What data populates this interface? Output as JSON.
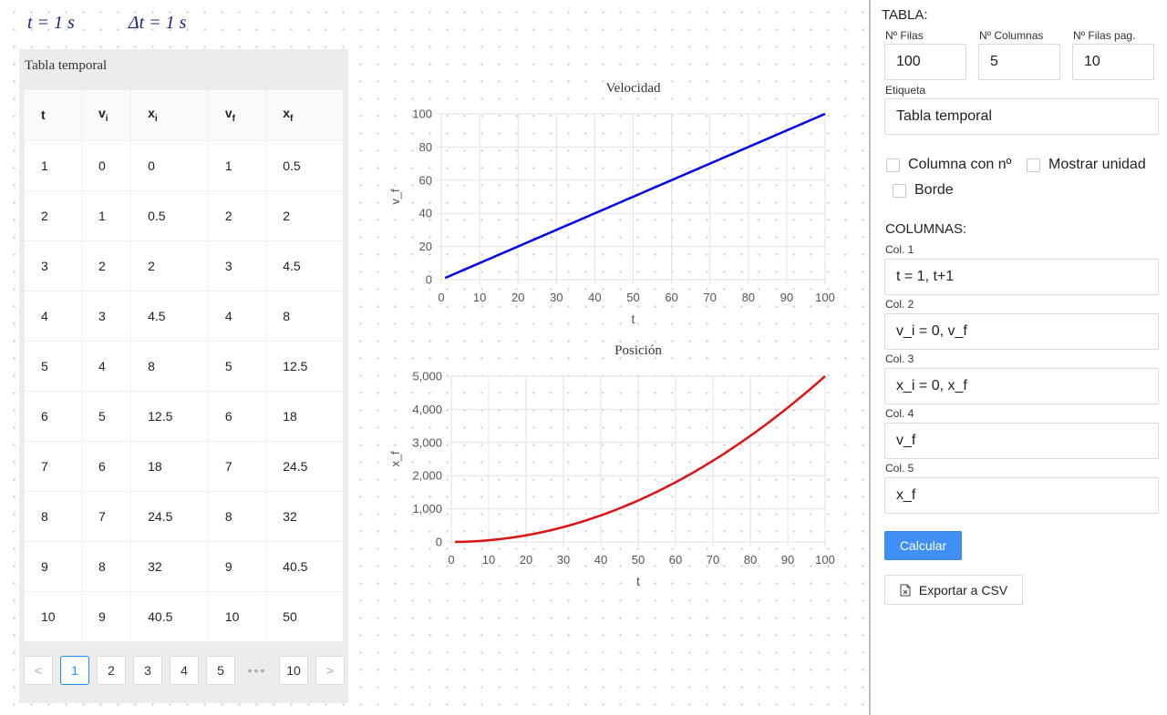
{
  "readout": {
    "time": "t = 1 s",
    "dt": "Δt = 1 s"
  },
  "table": {
    "caption": "Tabla temporal",
    "headers": [
      {
        "base": "t",
        "sub": ""
      },
      {
        "base": "v",
        "sub": "i"
      },
      {
        "base": "x",
        "sub": "i"
      },
      {
        "base": "v",
        "sub": "f"
      },
      {
        "base": "x",
        "sub": "f"
      }
    ],
    "rows": [
      [
        "1",
        "0",
        "0",
        "1",
        "0.5"
      ],
      [
        "2",
        "1",
        "0.5",
        "2",
        "2"
      ],
      [
        "3",
        "2",
        "2",
        "3",
        "4.5"
      ],
      [
        "4",
        "3",
        "4.5",
        "4",
        "8"
      ],
      [
        "5",
        "4",
        "8",
        "5",
        "12.5"
      ],
      [
        "6",
        "5",
        "12.5",
        "6",
        "18"
      ],
      [
        "7",
        "6",
        "18",
        "7",
        "24.5"
      ],
      [
        "8",
        "7",
        "24.5",
        "8",
        "32"
      ],
      [
        "9",
        "8",
        "32",
        "9",
        "40.5"
      ],
      [
        "10",
        "9",
        "40.5",
        "10",
        "50"
      ]
    ]
  },
  "pagination": {
    "prev": "<",
    "pages": [
      "1",
      "2",
      "3",
      "4",
      "5"
    ],
    "ellipsis": "•••",
    "last": "10",
    "next": ">",
    "current": "1"
  },
  "chart_data": [
    {
      "type": "line",
      "title": "Velocidad",
      "xlabel": "t",
      "ylabel": "v_f",
      "xlim": [
        0,
        100
      ],
      "ylim": [
        0,
        100
      ],
      "xticks": [
        0,
        10,
        20,
        30,
        40,
        50,
        60,
        70,
        80,
        90,
        100
      ],
      "yticks": [
        0,
        20,
        40,
        60,
        80,
        100
      ],
      "ytick_labels": [
        "0",
        "20",
        "40",
        "60",
        "80",
        "100"
      ],
      "grid": true,
      "color": "#0000ee",
      "series": [
        {
          "function": "v_f = t",
          "x_range": [
            1,
            100
          ]
        }
      ]
    },
    {
      "type": "line",
      "title": "Posición",
      "xlabel": "t",
      "ylabel": "x_f",
      "xlim": [
        0,
        100
      ],
      "ylim": [
        0,
        5000
      ],
      "xticks": [
        0,
        10,
        20,
        30,
        40,
        50,
        60,
        70,
        80,
        90,
        100
      ],
      "yticks": [
        0,
        1000,
        2000,
        3000,
        4000,
        5000
      ],
      "ytick_labels": [
        "0",
        "1,000",
        "2,000",
        "3,000",
        "4,000",
        "5,000"
      ],
      "grid": true,
      "color": "#dd1111",
      "series": [
        {
          "function": "x_f = t^2/2",
          "x_range": [
            1,
            100
          ]
        }
      ]
    }
  ],
  "side": {
    "title": "TABLA:",
    "rows_label": "Nº Filas",
    "rows_value": "100",
    "cols_label": "Nº Columnas",
    "cols_value": "5",
    "page_rows_label": "Nº Filas pag.",
    "page_rows_value": "10",
    "tag_label": "Etiqueta",
    "tag_value": "Tabla temporal",
    "cb_numbered": "Columna con nº",
    "cb_units": "Mostrar unidad",
    "cb_border": "Borde",
    "columns_title": "COLUMNAS:",
    "columns": [
      {
        "label": "Col. 1",
        "value": "t = 1, t+1"
      },
      {
        "label": "Col. 2",
        "value": "v_i = 0, v_f"
      },
      {
        "label": "Col. 3",
        "value": "x_i = 0, x_f"
      },
      {
        "label": "Col. 4",
        "value": "v_f"
      },
      {
        "label": "Col. 5",
        "value": "x_f"
      }
    ],
    "calc_button": "Calcular",
    "export_button": "Exportar a CSV",
    "accent": "#3f8ff5"
  }
}
